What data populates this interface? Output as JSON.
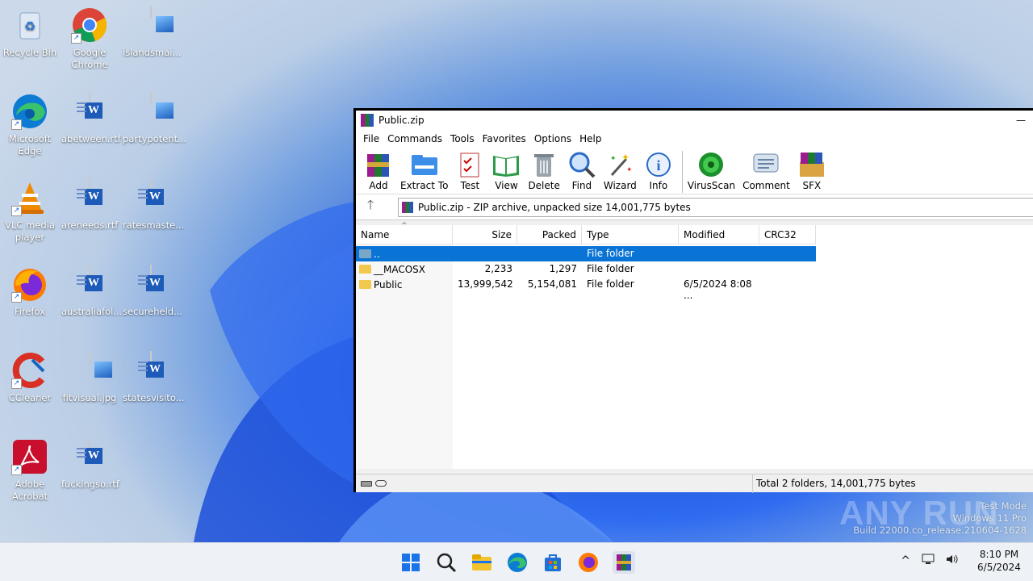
{
  "desktop": {
    "icons": [
      {
        "label": "Recycle Bin",
        "icon": "recycle-bin-icon"
      },
      {
        "label": "Google Chrome",
        "icon": "chrome-icon"
      },
      {
        "label": "islandsmai...",
        "icon": "image-file-icon"
      },
      {
        "label": "Microsoft Edge",
        "icon": "edge-icon"
      },
      {
        "label": "abetween.rtf",
        "icon": "word-doc-icon"
      },
      {
        "label": "partypotent...",
        "icon": "image-file-icon"
      },
      {
        "label": "VLC media player",
        "icon": "vlc-icon"
      },
      {
        "label": "areneeds.rtf",
        "icon": "word-doc-icon"
      },
      {
        "label": "ratesmaste...",
        "icon": "word-doc-icon"
      },
      {
        "label": "Firefox",
        "icon": "firefox-icon"
      },
      {
        "label": "australiafol...",
        "icon": "word-doc-icon"
      },
      {
        "label": "secureheld...",
        "icon": "word-doc-icon"
      },
      {
        "label": "CCleaner",
        "icon": "ccleaner-icon"
      },
      {
        "label": "fitvisual.jpg",
        "icon": "image-file-icon"
      },
      {
        "label": "statesvisito...",
        "icon": "word-doc-icon"
      },
      {
        "label": "Adobe Acrobat",
        "icon": "acrobat-icon"
      },
      {
        "label": "fuckingso.rtf",
        "icon": "word-doc-icon"
      }
    ]
  },
  "window": {
    "title": "Public.zip",
    "minimize_symbol": "—",
    "menu": [
      "File",
      "Commands",
      "Tools",
      "Favorites",
      "Options",
      "Help"
    ],
    "toolbar": [
      {
        "label": "Add",
        "icon": "add-archive-icon"
      },
      {
        "label": "Extract To",
        "icon": "extract-folder-icon"
      },
      {
        "label": "Test",
        "icon": "test-checklist-icon"
      },
      {
        "label": "View",
        "icon": "view-book-icon"
      },
      {
        "label": "Delete",
        "icon": "trash-icon"
      },
      {
        "label": "Find",
        "icon": "magnifier-icon"
      },
      {
        "label": "Wizard",
        "icon": "magic-wand-icon"
      },
      {
        "label": "Info",
        "icon": "info-icon"
      },
      {
        "label": "VirusScan",
        "icon": "virus-scan-icon"
      },
      {
        "label": "Comment",
        "icon": "comment-icon"
      },
      {
        "label": "SFX",
        "icon": "sfx-box-icon"
      }
    ],
    "up_symbol": "🡑",
    "address": "Public.zip - ZIP archive, unpacked size 14,001,775 bytes",
    "columns": {
      "name": "Name",
      "size": "Size",
      "packed": "Packed",
      "type": "Type",
      "modified": "Modified",
      "crc": "CRC32"
    },
    "rows": [
      {
        "name": "..",
        "size": "",
        "packed": "",
        "type": "File folder",
        "modified": ""
      },
      {
        "name": "__MACOSX",
        "size": "2,233",
        "packed": "1,297",
        "type": "File folder",
        "modified": ""
      },
      {
        "name": "Public",
        "size": "13,999,542",
        "packed": "5,154,081",
        "type": "File folder",
        "modified": "6/5/2024 8:08 ..."
      }
    ],
    "status_total": "Total 2 folders, 14,001,775 bytes"
  },
  "watermark": {
    "brand": "ANY RUN",
    "line1": "Test Mode",
    "line2": "Windows 11 Pro",
    "line3": "Build 22000.co_release.210604-1628"
  },
  "taskbar": {
    "apps": [
      "start-icon",
      "search-icon",
      "file-explorer-icon",
      "edge-icon",
      "store-icon",
      "firefox-icon",
      "winrar-icon"
    ],
    "tray_chevron": "^",
    "time": "8:10 PM",
    "date": "6/5/2024"
  },
  "colors": {
    "selection": "#0a74d6",
    "taskbar_bg": "#eef1f6",
    "wallpaper_blue": "#1f55db"
  }
}
